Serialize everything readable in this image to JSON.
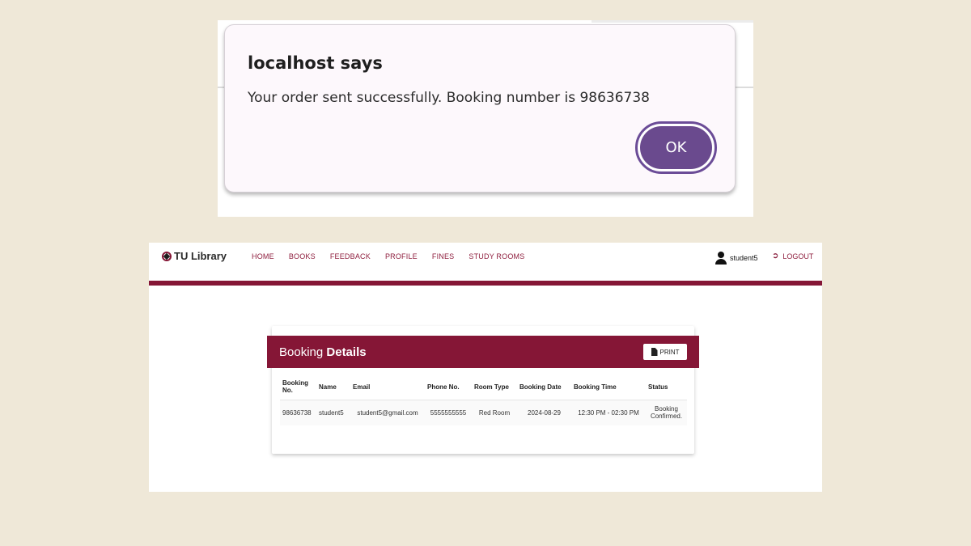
{
  "alert": {
    "title": "localhost says",
    "message": "Your order sent successfully. Booking number is 98636738",
    "ok_label": "OK"
  },
  "navbar": {
    "brand": "TU Library",
    "links": [
      "HOME",
      "BOOKS",
      "FEEDBACK",
      "PROFILE",
      "FINES",
      "STUDY ROOMS"
    ],
    "username": "student5",
    "logout_label": "LOGOUT",
    "accent_color": "#851636"
  },
  "booking": {
    "title_plain": "Booking",
    "title_bold": "Details",
    "print_label": "PRINT",
    "columns": [
      "Booking No.",
      "Name",
      "Email",
      "Phone No.",
      "Room Type",
      "Booking Date",
      "Booking Time",
      "Status"
    ],
    "rows": [
      [
        "98636738",
        "student5",
        "student5@gmail.com",
        "5555555555",
        "Red Room",
        "2024-08-29",
        "12:30 PM - 02:30 PM",
        "Booking Confirmed."
      ]
    ]
  }
}
